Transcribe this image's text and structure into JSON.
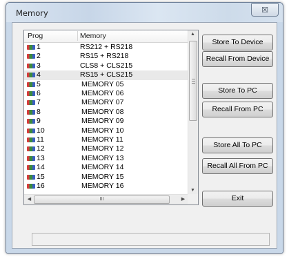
{
  "window": {
    "title": "Memory",
    "close_glyph": "☒"
  },
  "list": {
    "columns": [
      "Prog",
      "Memory"
    ],
    "rows": [
      {
        "prog": "1",
        "memory": "RS212 + RS218"
      },
      {
        "prog": "2",
        "memory": "RS15 + RS218"
      },
      {
        "prog": "3",
        "memory": "CLS8 + CLS215"
      },
      {
        "prog": "4",
        "memory": "RS15 + CLS215"
      },
      {
        "prog": "5",
        "memory": "MEMORY 05"
      },
      {
        "prog": "6",
        "memory": "MEMORY 06"
      },
      {
        "prog": "7",
        "memory": "MEMORY 07"
      },
      {
        "prog": "8",
        "memory": "MEMORY 08"
      },
      {
        "prog": "9",
        "memory": "MEMORY 09"
      },
      {
        "prog": "10",
        "memory": "MEMORY 10"
      },
      {
        "prog": "11",
        "memory": "MEMORY 11"
      },
      {
        "prog": "12",
        "memory": "MEMORY 12"
      },
      {
        "prog": "13",
        "memory": "MEMORY 13"
      },
      {
        "prog": "14",
        "memory": "MEMORY 14"
      },
      {
        "prog": "15",
        "memory": "MEMORY 15"
      },
      {
        "prog": "16",
        "memory": "MEMORY 16"
      }
    ],
    "selected_row": "4",
    "hscroll_grip": "III"
  },
  "buttons": {
    "store_to_device": "Store To Device",
    "recall_from_device": "Recall From Device",
    "store_to_pc": "Store To PC",
    "recall_from_pc": "Recall From PC",
    "store_all_to_pc": "Store All To PC",
    "recall_all_from_pc": "Recall All From PC",
    "exit": "Exit"
  },
  "status_bar": {
    "text": ""
  },
  "icons": {
    "row_icon": "memory-chip-icon",
    "scroll_up": "▲",
    "scroll_down": "▼",
    "scroll_left": "◀",
    "scroll_right": "▶"
  }
}
